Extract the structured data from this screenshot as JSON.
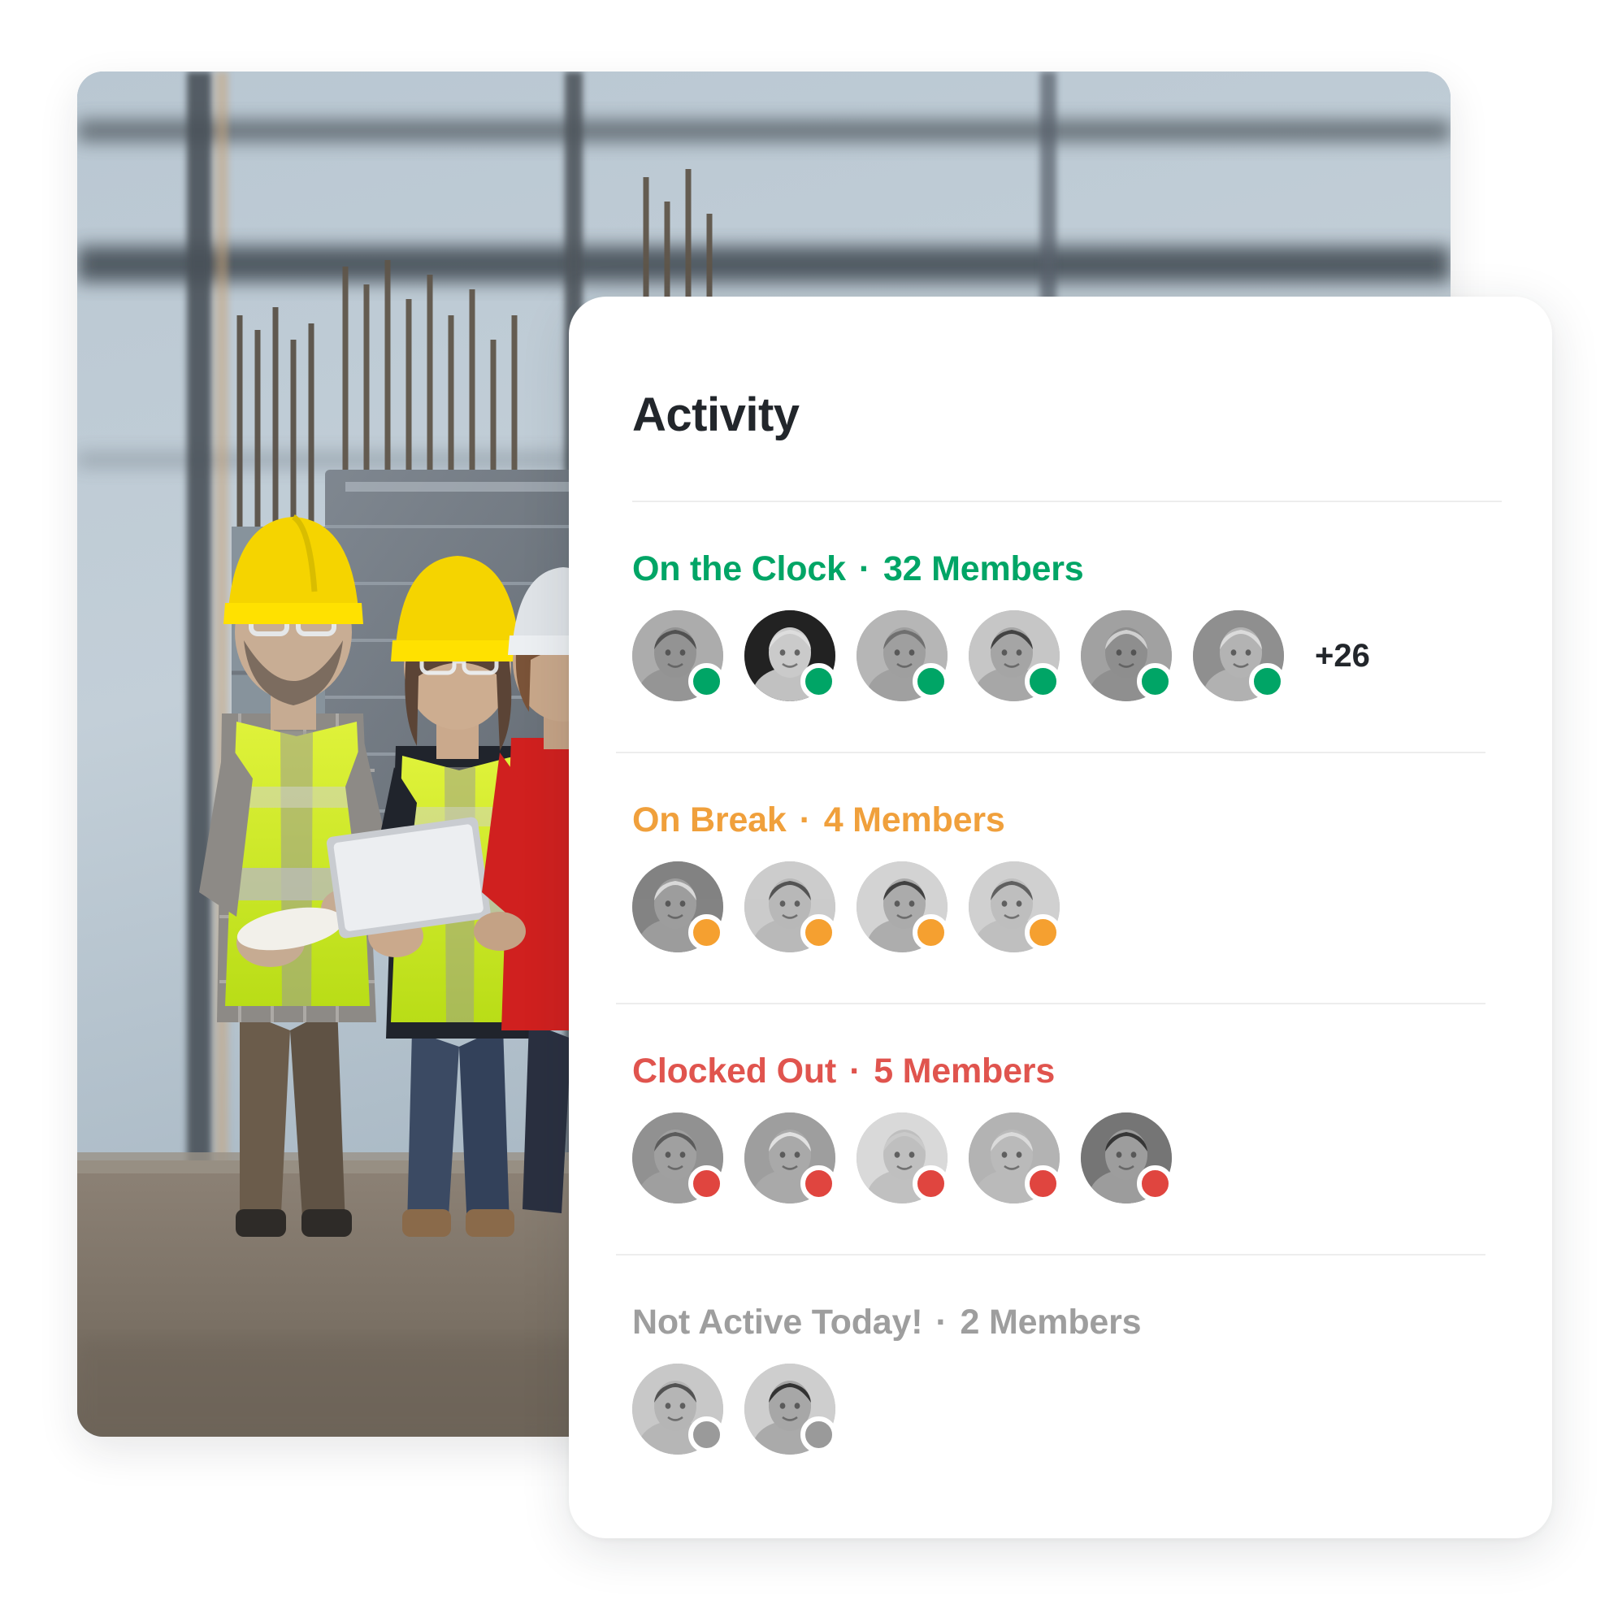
{
  "card": {
    "title": "Activity",
    "sections": [
      {
        "id": "on-the-clock",
        "label": "On the Clock",
        "separator": "·",
        "count_label": "32 Members",
        "color": "#00A566",
        "dot_color": "#00A566",
        "overflow_label": "+26",
        "avatars": [
          {
            "name": "avatar-curly-hair-worker",
            "tone": "#8f8f8f",
            "hair": "#4a4a4a",
            "bg": "#a9a9a9"
          },
          {
            "name": "avatar-smiling-young-man",
            "tone": "#c8c8c8",
            "hair": "#dcdcdc",
            "bg": "#1a1a1a"
          },
          {
            "name": "avatar-worker-with-cap",
            "tone": "#9c9c9c",
            "hair": "#6a6a6a",
            "bg": "#b4b4b4"
          },
          {
            "name": "avatar-man-with-glasses",
            "tone": "#a2a2a2",
            "hair": "#3c3c3c",
            "bg": "#c4c4c4"
          },
          {
            "name": "avatar-worker-hardhat",
            "tone": "#8a8a8a",
            "hair": "#cfcfcf",
            "bg": "#9e9e9e"
          },
          {
            "name": "avatar-welder-safety-glasses",
            "tone": "#b0b0b0",
            "hair": "#dadada",
            "bg": "#8b8b8b"
          }
        ]
      },
      {
        "id": "on-break",
        "label": "On Break",
        "separator": "·",
        "count_label": "4 Members",
        "color": "#F0A03C",
        "dot_color": "#F5A030",
        "overflow_label": "",
        "avatars": [
          {
            "name": "avatar-older-man-cap",
            "tone": "#9a9a9a",
            "hair": "#d8d8d8",
            "bg": "#7e7e7e"
          },
          {
            "name": "avatar-curly-haired-woman",
            "tone": "#b6b6b6",
            "hair": "#4e4e4e",
            "bg": "#c9c9c9"
          },
          {
            "name": "avatar-smiling-woman-phone",
            "tone": "#a8a8a8",
            "hair": "#3a3a3a",
            "bg": "#d2d2d2"
          },
          {
            "name": "avatar-man-glasses-white-shirt",
            "tone": "#bcbcbc",
            "hair": "#5a5a5a",
            "bg": "#cfcfcf"
          }
        ]
      },
      {
        "id": "clocked-out",
        "label": "Clocked Out",
        "separator": "·",
        "count_label": "5 Members",
        "color": "#E0544E",
        "dot_color": "#E0453F",
        "overflow_label": "",
        "avatars": [
          {
            "name": "avatar-laughing-worker-helmet",
            "tone": "#9d9d9d",
            "hair": "#555555",
            "bg": "#8d8d8d"
          },
          {
            "name": "avatar-older-man-smiling",
            "tone": "#a6a6a6",
            "hair": "#e0e0e0",
            "bg": "#9b9b9b"
          },
          {
            "name": "avatar-short-hair-woman",
            "tone": "#bdbdbd",
            "hair": "#c8c8c8",
            "bg": "#d8d8d8"
          },
          {
            "name": "avatar-blonde-woman",
            "tone": "#b8b8b8",
            "hair": "#dadada",
            "bg": "#b0b0b0"
          },
          {
            "name": "avatar-dark-hair-woman",
            "tone": "#9a9a9a",
            "hair": "#2e2e2e",
            "bg": "#707070"
          }
        ]
      },
      {
        "id": "not-active-today",
        "label": "Not Active Today!",
        "separator": "·",
        "count_label": "2 Members",
        "color": "#9E9E9E",
        "dot_color": "#9A9A9A",
        "overflow_label": "",
        "avatars": [
          {
            "name": "avatar-woman-in-blazer",
            "tone": "#b2b2b2",
            "hair": "#4b4b4b",
            "bg": "#c6c6c6"
          },
          {
            "name": "avatar-man-in-cap-white-tee",
            "tone": "#a4a4a4",
            "hair": "#2a2a2a",
            "bg": "#cccccc"
          }
        ]
      }
    ]
  },
  "photo": {
    "alt_label": "construction site workers reviewing plans"
  }
}
